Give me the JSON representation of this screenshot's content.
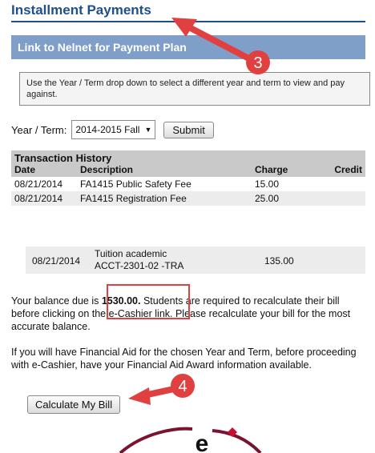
{
  "page": {
    "title": "Installment Payments"
  },
  "nelnet": {
    "label": "Link to Nelnet for Payment Plan"
  },
  "instructions": {
    "text": "Use the Year / Term drop down to select a different year and term to view and pay against."
  },
  "term": {
    "label": "Year / Term:",
    "selected": "2014-2015 Fall",
    "submit_label": "Submit"
  },
  "history": {
    "title": "Transaction History",
    "columns": [
      "Date",
      "Description",
      "Charge",
      "Credit"
    ],
    "rows": [
      {
        "date": "08/21/2014",
        "description": "FA1415 Public Safety Fee",
        "charge": "15.00",
        "credit": ""
      },
      {
        "date": "08/21/2014",
        "description": "FA1415 Registration Fee",
        "charge": "25.00",
        "credit": ""
      }
    ],
    "tuition": {
      "date": "08/21/2014",
      "description_line1": "Tuition academic",
      "description_line2": "ACCT-2301-02 -TRA",
      "charge": "135.00"
    }
  },
  "balance": {
    "prefix": "Your balance due is ",
    "amount": "1530.00.",
    "suffix": " Students are required to recalculate their bill before clicking on the e-Cashier link. Please recalculate your bill for the most accurate balance."
  },
  "aid": {
    "text": "If you will have Financial Aid for the chosen Year and Term, before proceeding with e-Cashier, have your Financial Aid Award information available."
  },
  "calculate": {
    "label": "Calculate My Bill"
  },
  "callouts": {
    "step3": "3",
    "step4": "4"
  },
  "colors": {
    "title": "#1f4f8f",
    "nelnet_bar": "#7f9fc9",
    "callout": "#e04040",
    "logo": "#7a1230"
  },
  "logo": {
    "letter": "e"
  }
}
